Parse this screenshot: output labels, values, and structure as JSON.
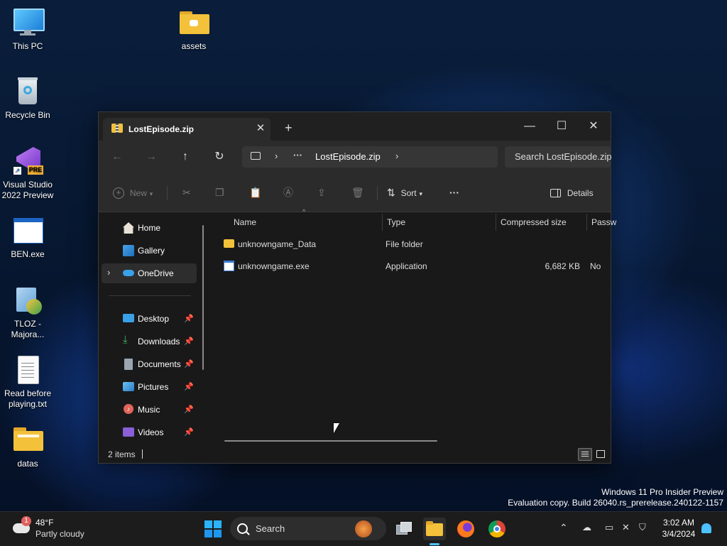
{
  "desktop": {
    "icons": [
      {
        "label": "This PC",
        "icon": "monitor-icon"
      },
      {
        "label": "assets",
        "icon": "folder-icon"
      },
      {
        "label": "Recycle Bin",
        "icon": "recycle-bin-icon"
      },
      {
        "label": "Visual Studio 2022 Preview",
        "badge": "PRE",
        "icon": "visual-studio-icon"
      },
      {
        "label": "BEN.exe",
        "icon": "exe-window-icon"
      },
      {
        "label": "TLOZ - Majora...",
        "icon": "installer-icon"
      },
      {
        "label": "Read before playing.txt",
        "icon": "text-file-icon"
      },
      {
        "label": "datas",
        "icon": "folder-icon"
      }
    ]
  },
  "window": {
    "tab_title": "LostEpisode.zip",
    "tab_close": "✕",
    "new_tab": "+",
    "controls": {
      "minimize": "—",
      "maximize": "☐",
      "close": "✕"
    },
    "nav": {
      "back": "←",
      "forward": "→",
      "up": "↑",
      "refresh": "↻"
    },
    "breadcrumb": {
      "more": "···",
      "current": "LostEpisode.zip"
    },
    "search_placeholder": "Search LostEpisode.zip",
    "toolbar": {
      "new": "New",
      "sort": "Sort",
      "more": "···",
      "details": "Details"
    },
    "sidebar": {
      "home": "Home",
      "gallery": "Gallery",
      "onedrive": "OneDrive",
      "pinned": [
        {
          "label": "Desktop",
          "icon": "desktop-icon",
          "color": "#3aa0e8"
        },
        {
          "label": "Downloads",
          "icon": "download-icon",
          "color": "#3fb85f"
        },
        {
          "label": "Documents",
          "icon": "document-icon",
          "color": "#9aa6b2"
        },
        {
          "label": "Pictures",
          "icon": "pictures-icon",
          "color": "#4aa3e0"
        },
        {
          "label": "Music",
          "icon": "music-icon",
          "color": "#e0655a"
        },
        {
          "label": "Videos",
          "icon": "videos-icon",
          "color": "#8a5fd8"
        }
      ]
    },
    "columns": {
      "name": "Name",
      "type": "Type",
      "compressed_size": "Compressed size",
      "password": "Passw"
    },
    "files": [
      {
        "name": "unknowngame_Data",
        "type": "File folder",
        "size": "",
        "password": "",
        "icon": "folder-icon"
      },
      {
        "name": "unknowngame.exe",
        "type": "Application",
        "size": "6,682 KB",
        "password": "No",
        "icon": "application-icon"
      }
    ],
    "status": {
      "items": "2 items"
    }
  },
  "watermark": {
    "line1": "Windows 11 Pro Insider Preview",
    "line2": "Evaluation copy. Build 26040.rs_prerelease.240122-1157"
  },
  "taskbar": {
    "weather": {
      "temp": "48°F",
      "condition": "Partly cloudy",
      "badge": "1"
    },
    "search_label": "Search",
    "clock": {
      "time": "3:02 AM",
      "date": "3/4/2024"
    }
  },
  "colors": {
    "accent": "#4cc2ff",
    "folder": "#f3c13a",
    "window_bg": "#191919",
    "taskbar_bg": "#1c1c1c"
  }
}
